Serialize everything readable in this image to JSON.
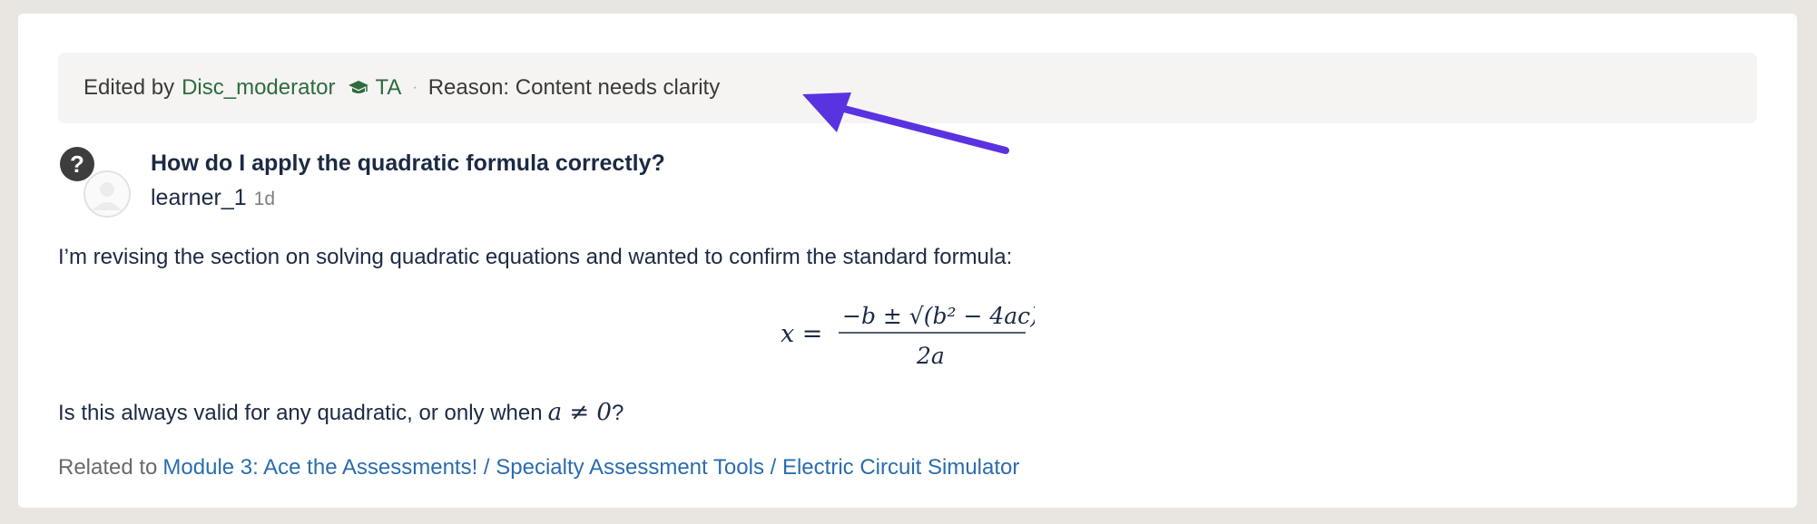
{
  "edit_banner": {
    "prefix": "Edited by",
    "editor": "Disc_moderator",
    "role_badge": "TA",
    "role_icon": "graduation-cap-icon",
    "separator": "·",
    "reason": "Reason: Content needs clarity"
  },
  "annotation": {
    "arrow_color": "#5a33e0"
  },
  "post": {
    "badge_glyph": "?",
    "title": "How do I apply the quadratic formula correctly?",
    "author": "learner_1",
    "age": "1d",
    "body": "I’m revising the section on solving quadratic equations and wanted to confirm the standard formula:",
    "formula": {
      "lhs": "x =",
      "numerator": "−b ± √(b² − 4ac)",
      "denominator": "2a"
    },
    "question_prefix": "Is this always valid for any quadratic, or only when",
    "question_math": "a ≠ 0",
    "question_suffix": "?",
    "related_prefix": "Related to",
    "related_link": "Module 3: Ace the Assessments! / Specialty Assessment Tools / Electric Circuit Simulator"
  },
  "colors": {
    "page_bg": "#e9e6e2",
    "editor_green": "#2e6b3f",
    "link_blue": "#2a6cb0",
    "text_navy": "#1b2a44"
  }
}
